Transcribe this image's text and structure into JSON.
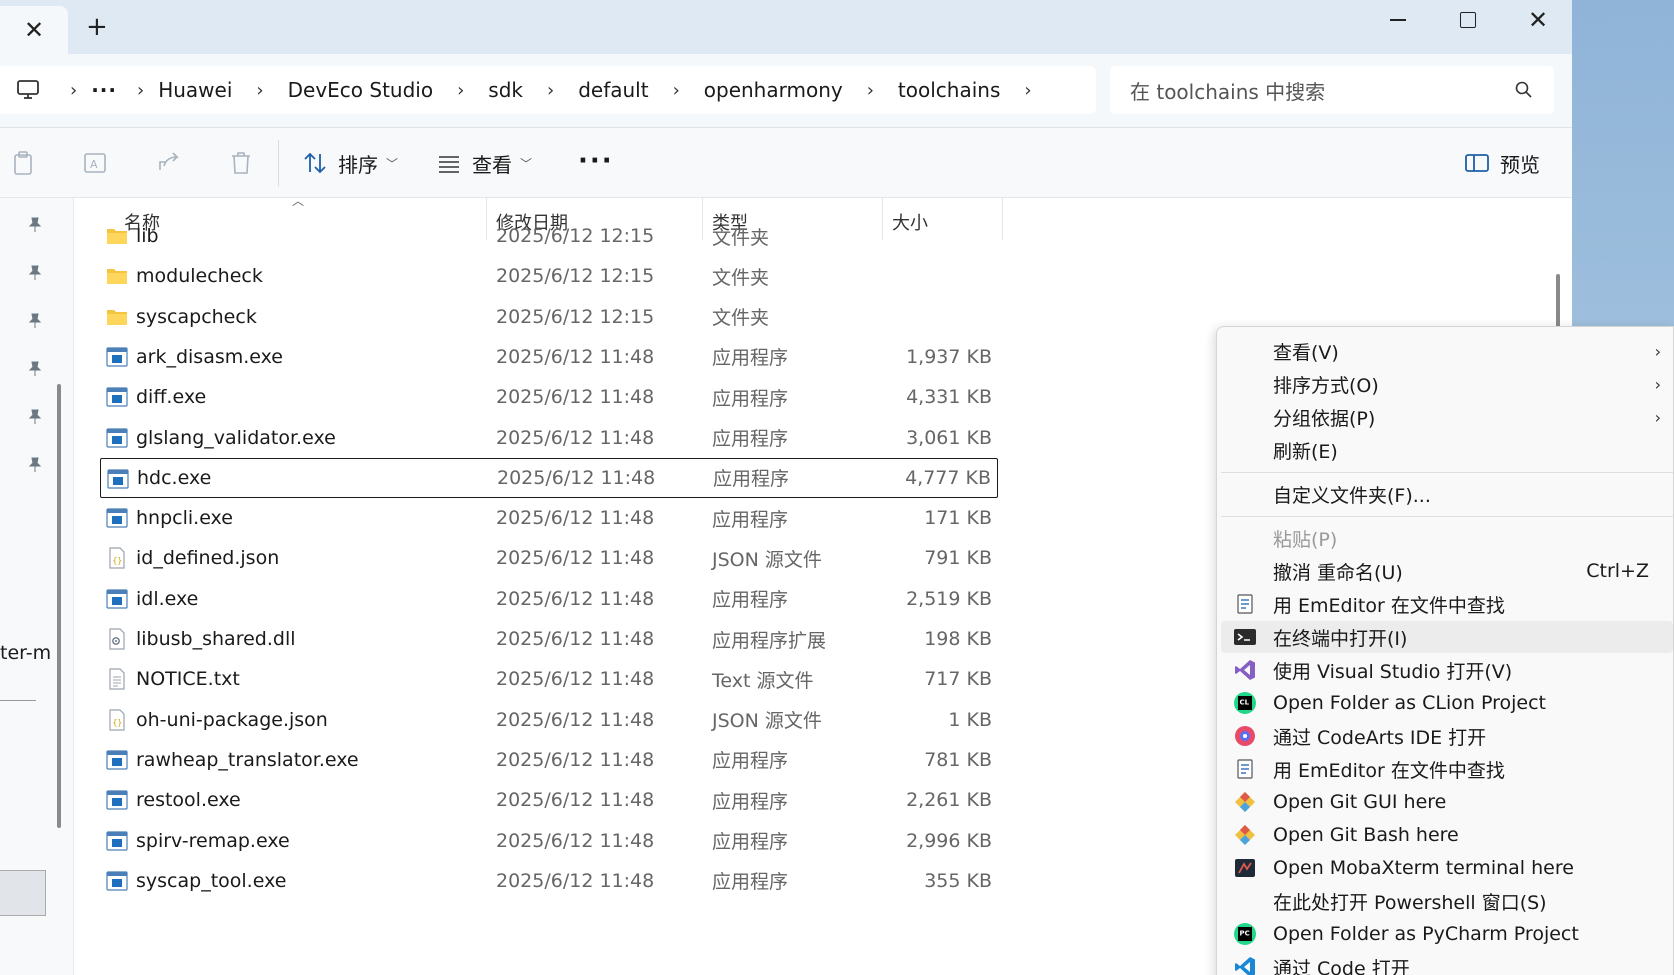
{
  "titlebar": {
    "close_tab_glyph": "✕",
    "new_tab_glyph": "+",
    "close_window_glyph": "✕"
  },
  "address": {
    "more": "···",
    "separator": "›",
    "crumbs": [
      "Huawei",
      "DevEco Studio",
      "sdk",
      "default",
      "openharmony",
      "toolchains"
    ]
  },
  "search": {
    "placeholder": "在 toolchains 中搜索"
  },
  "toolbar": {
    "sort_label": "排序",
    "view_label": "查看",
    "more_label": "···",
    "preview_label": "预览"
  },
  "columns": {
    "name": "名称",
    "date": "修改日期",
    "type": "类型",
    "size": "大小"
  },
  "sidebar_partial_text": "ter-m",
  "files": [
    {
      "name": "lib",
      "date": "2025/6/12 12:15",
      "type": "文件夹",
      "size": "",
      "icon": "folder-icon"
    },
    {
      "name": "modulecheck",
      "date": "2025/6/12 12:15",
      "type": "文件夹",
      "size": "",
      "icon": "folder-icon"
    },
    {
      "name": "syscapcheck",
      "date": "2025/6/12 12:15",
      "type": "文件夹",
      "size": "",
      "icon": "folder-icon"
    },
    {
      "name": "ark_disasm.exe",
      "date": "2025/6/12 11:48",
      "type": "应用程序",
      "size": "1,937 KB",
      "icon": "exe-icon"
    },
    {
      "name": "diff.exe",
      "date": "2025/6/12 11:48",
      "type": "应用程序",
      "size": "4,331 KB",
      "icon": "exe-icon"
    },
    {
      "name": "glslang_validator.exe",
      "date": "2025/6/12 11:48",
      "type": "应用程序",
      "size": "3,061 KB",
      "icon": "exe-icon"
    },
    {
      "name": "hdc.exe",
      "date": "2025/6/12 11:48",
      "type": "应用程序",
      "size": "4,777 KB",
      "icon": "exe-icon",
      "selected": true
    },
    {
      "name": "hnpcli.exe",
      "date": "2025/6/12 11:48",
      "type": "应用程序",
      "size": "171 KB",
      "icon": "exe-icon"
    },
    {
      "name": "id_defined.json",
      "date": "2025/6/12 11:48",
      "type": "JSON 源文件",
      "size": "791 KB",
      "icon": "json-icon"
    },
    {
      "name": "idl.exe",
      "date": "2025/6/12 11:48",
      "type": "应用程序",
      "size": "2,519 KB",
      "icon": "exe-icon"
    },
    {
      "name": "libusb_shared.dll",
      "date": "2025/6/12 11:48",
      "type": "应用程序扩展",
      "size": "198 KB",
      "icon": "dll-icon"
    },
    {
      "name": "NOTICE.txt",
      "date": "2025/6/12 11:48",
      "type": "Text 源文件",
      "size": "717 KB",
      "icon": "txt-icon"
    },
    {
      "name": "oh-uni-package.json",
      "date": "2025/6/12 11:48",
      "type": "JSON 源文件",
      "size": "1 KB",
      "icon": "json-icon"
    },
    {
      "name": "rawheap_translator.exe",
      "date": "2025/6/12 11:48",
      "type": "应用程序",
      "size": "781 KB",
      "icon": "exe-icon"
    },
    {
      "name": "restool.exe",
      "date": "2025/6/12 11:48",
      "type": "应用程序",
      "size": "2,261 KB",
      "icon": "exe-icon"
    },
    {
      "name": "spirv-remap.exe",
      "date": "2025/6/12 11:48",
      "type": "应用程序",
      "size": "2,996 KB",
      "icon": "exe-icon"
    },
    {
      "name": "syscap_tool.exe",
      "date": "2025/6/12 11:48",
      "type": "应用程序",
      "size": "355 KB",
      "icon": "exe-icon"
    }
  ],
  "context_menu": {
    "items": [
      {
        "label": "查看(V)",
        "arrow": "›"
      },
      {
        "label": "排序方式(O)",
        "arrow": "›"
      },
      {
        "label": "分组依据(P)",
        "arrow": "›"
      },
      {
        "label": "刷新(E)"
      },
      {
        "label": "自定义文件夹(F)..."
      },
      {
        "label": "粘贴(P)"
      },
      {
        "label": "撤消 重命名(U)",
        "shortcut": "Ctrl+Z"
      },
      {
        "label": "用 EmEditor 在文件中查找",
        "icon": "emeditor-icon"
      },
      {
        "label": "在终端中打开(I)",
        "icon": "terminal-icon"
      },
      {
        "label": "使用 Visual Studio 打开(V)",
        "icon": "visual-studio-icon"
      },
      {
        "label": "Open Folder as CLion Project",
        "icon": "clion-icon"
      },
      {
        "label": "通过 CodeArts IDE 打开",
        "icon": "codearts-icon"
      },
      {
        "label": "用 EmEditor 在文件中查找",
        "icon": "emeditor-icon"
      },
      {
        "label": "Open Git GUI here",
        "icon": "git-gui-icon"
      },
      {
        "label": "Open Git Bash here",
        "icon": "git-bash-icon"
      },
      {
        "label": "Open MobaXterm terminal here",
        "icon": "mobaxterm-icon"
      },
      {
        "label": "在此处打开 Powershell 窗口(S)"
      },
      {
        "label": "Open Folder as PyCharm Project",
        "icon": "pycharm-icon"
      },
      {
        "label": "通过 Code 打开",
        "icon": "vscode-icon"
      }
    ]
  },
  "colors": {
    "accent": "#0067c0",
    "folder": "#f5c542",
    "titlebar_bg": "#dfe9f4"
  }
}
